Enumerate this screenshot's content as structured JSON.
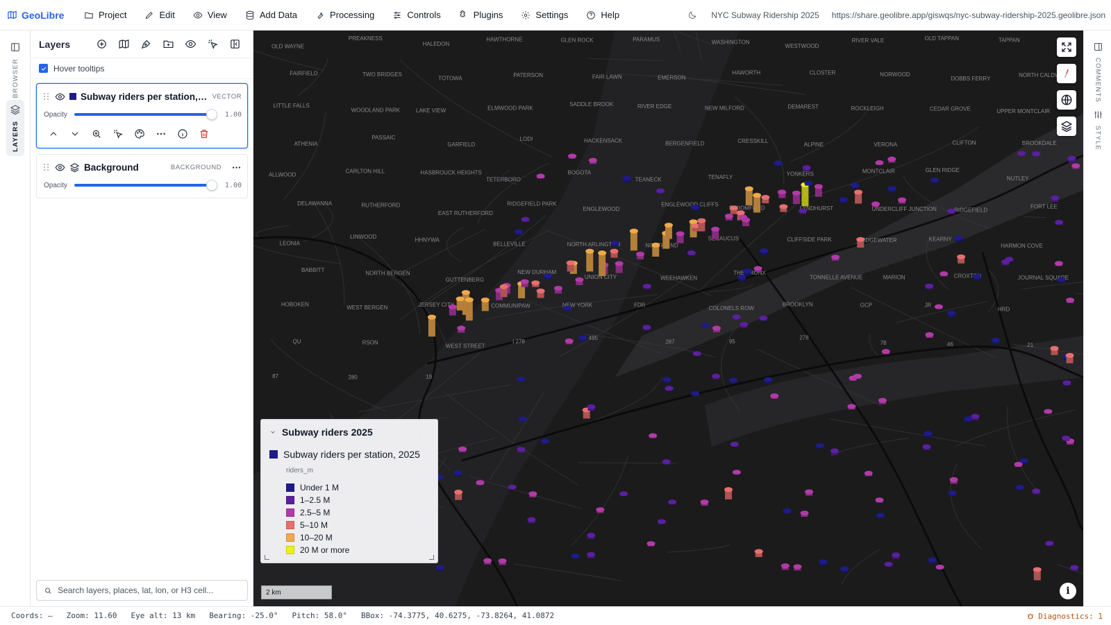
{
  "app": {
    "name": "GeoLibre"
  },
  "menu": [
    {
      "label": "Project",
      "icon": "folder-icon"
    },
    {
      "label": "Edit",
      "icon": "pencil-icon"
    },
    {
      "label": "View",
      "icon": "eye-icon"
    },
    {
      "label": "Add Data",
      "icon": "database-icon"
    },
    {
      "label": "Processing",
      "icon": "wrench-icon"
    },
    {
      "label": "Controls",
      "icon": "sliders-icon"
    },
    {
      "label": "Plugins",
      "icon": "puzzle-icon"
    },
    {
      "label": "Settings",
      "icon": "gear-icon"
    },
    {
      "label": "Help",
      "icon": "help-icon"
    }
  ],
  "header": {
    "project_title": "NYC Subway Ridership 2025",
    "share_url": "https://share.geolibre.app/giswqs/nyc-subway-ridership-2025.geolibre.json"
  },
  "left_rail": {
    "browser_label": "BROWSER",
    "layers_label": "LAYERS"
  },
  "right_rail": {
    "comments_label": "COMMENTS",
    "style_label": "STYLE"
  },
  "panel": {
    "title": "Layers",
    "hover_tooltips_label": "Hover tooltips",
    "hover_tooltips_checked": true,
    "layers": [
      {
        "name": "Subway riders per station, 2025",
        "tag": "VECTOR",
        "opacity_label": "Opacity",
        "opacity": "1.00",
        "swatch": "#1e1b8a"
      },
      {
        "name": "Background",
        "tag": "BACKGROUND",
        "opacity_label": "Opacity",
        "opacity": "1.00"
      }
    ],
    "search_placeholder": "Search layers, places, lat, lon, or H3 cell..."
  },
  "legend": {
    "title": "Subway riders 2025",
    "layer_name": "Subway riders per station, 2025",
    "field": "riders_m",
    "items": [
      {
        "label": "Under 1 M",
        "color": "#1e1b8a"
      },
      {
        "label": "1–2.5 M",
        "color": "#5b1fa0"
      },
      {
        "label": "2.5–5 M",
        "color": "#b23aa8"
      },
      {
        "label": "5–10 M",
        "color": "#e86f6f"
      },
      {
        "label": "10–20 M",
        "color": "#f0a94a"
      },
      {
        "label": "20 M or more",
        "color": "#eef01f"
      }
    ]
  },
  "map": {
    "scale_label": "2 km",
    "labels": [
      "OLD WAYNE",
      "PREAKNESS",
      "HALEDON",
      "HAWTHORNE",
      "GLEN ROCK",
      "PARAMUS",
      "WASHINGTON",
      "WESTWOOD",
      "RIVER VALE",
      "OLD TAPPAN",
      "TAPPAN",
      "FAIRFIELD",
      "TWO BRIDGES",
      "TOTOWA",
      "PATERSON",
      "FAIR LAWN",
      "EMERSON",
      "HAWORTH",
      "CLOSTER",
      "NORWOOD",
      "DOBBS FERRY",
      "NORTH CALDWELL",
      "LITTLE FALLS",
      "WOODLAND PARK",
      "LAKE VIEW",
      "ELMWOOD PARK",
      "SADDLE BROOK",
      "RIVER EDGE",
      "NEW MILFORD",
      "DEMAREST",
      "ROCKLEIGH",
      "CEDAR GROVE",
      "UPPER MONTCLAIR",
      "ATHENIA",
      "PASSAIC",
      "GARFIELD",
      "LODI",
      "HACKENSACK",
      "BERGENFIELD",
      "CRESSKILL",
      "ALPINE",
      "VERONA",
      "CLIFTON",
      "BROOKDALE",
      "ALLWOOD",
      "CARLTON HILL",
      "HASBROUCK HEIGHTS",
      "TETERBORO",
      "BOGOTA",
      "TEANECK",
      "TENAFLY",
      "YONKERS",
      "MONTCLAIR",
      "GLEN RIDGE",
      "NUTLEY",
      "DELAWANNA",
      "RUTHERFORD",
      "EAST RUTHERFORD",
      "RIDGEFIELD PARK",
      "ENGLEWOOD",
      "ENGLEWOOD CLIFFS",
      "BLOOMFIELD",
      "LYNDHURST",
      "UNDERCLIFF JUNCTION",
      "RIDGEFIELD",
      "FORT LEE",
      "LEONIA",
      "LINWOOD",
      "HHNYWA",
      "BELLEVILLE",
      "NORTH ARLINGTON",
      "NORTH END",
      "SECAUCUS",
      "CLIFFSIDE PARK",
      "EDGEWATER",
      "KEARNY",
      "HARMON COVE",
      "BABBITT",
      "NORTH BERGEN",
      "GUTTENBERG",
      "NEW DURHAM",
      "UNION CITY",
      "WEEHAWKEN",
      "THE BRONX",
      "TONNELLE AVENUE",
      "MARION",
      "CROXTON",
      "JOURNAL SQUARE",
      "HOBOKEN",
      "WEST BERGEN",
      "JERSEY CITY",
      "COMMUNIPAW",
      "NEW YORK",
      "FDR",
      "COLONELS ROW",
      "BROOKLYN",
      "GCP",
      "JR",
      "HRD",
      "QU",
      "RSON",
      "WEST STREET",
      "I 278",
      "495",
      "287",
      "95",
      "278",
      "78",
      "46",
      "21",
      "87",
      "280",
      "19"
    ]
  },
  "status": {
    "coords": "Coords: —",
    "zoom": "Zoom: 11.60",
    "eye_alt": "Eye alt: 13 km",
    "bearing": "Bearing: -25.0°",
    "pitch": "Pitch: 58.0°",
    "bbox": "BBox: -74.3775, 40.6275, -73.8264, 41.0872",
    "diagnostics": "Diagnostics: 1"
  }
}
